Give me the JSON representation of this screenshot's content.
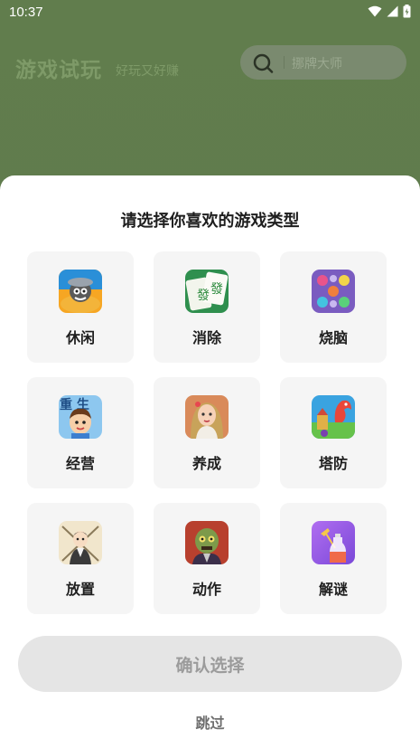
{
  "status_bar": {
    "time": "10:37"
  },
  "header": {
    "title": "游戏试玩",
    "slogan": "好玩又好赚",
    "search_placeholder": "挪牌大师"
  },
  "sheet": {
    "title": "请选择你喜欢的游戏类型",
    "categories": [
      {
        "label": "休闲",
        "icon": "casual-game-icon"
      },
      {
        "label": "消除",
        "icon": "mahjong-tile-icon"
      },
      {
        "label": "烧脑",
        "icon": "color-sort-puzzle-icon"
      },
      {
        "label": "经营",
        "icon": "cartoon-boy-icon"
      },
      {
        "label": "养成",
        "icon": "anime-girl-icon"
      },
      {
        "label": "塔防",
        "icon": "dragon-castle-icon"
      },
      {
        "label": "放置",
        "icon": "samurai-swords-icon"
      },
      {
        "label": "动作",
        "icon": "zombie-icon"
      },
      {
        "label": "解谜",
        "icon": "bottle-pour-icon"
      }
    ],
    "icon_overlay_text": {
      "cartoon_boy": "重 生"
    },
    "confirm_label": "确认选择",
    "skip_label": "跳过"
  },
  "colors": {
    "background_overlay": "#5f7a4c",
    "card_bg": "#f5f5f5",
    "button_disabled_bg": "#e5e5e5",
    "button_disabled_text": "#9b9b9b"
  }
}
